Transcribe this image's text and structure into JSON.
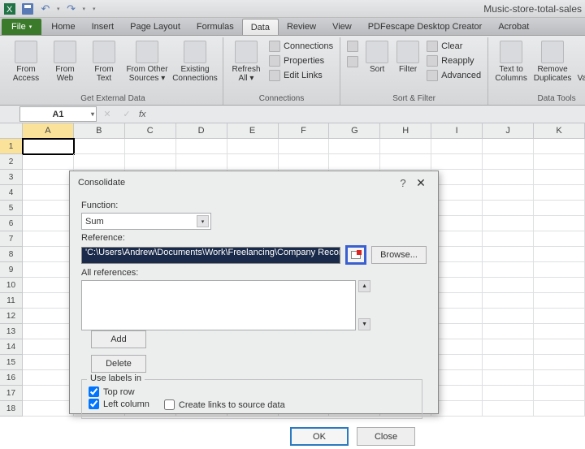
{
  "workbook_title": "Music-store-total-sales",
  "tabs": [
    "File",
    "Home",
    "Insert",
    "Page Layout",
    "Formulas",
    "Data",
    "Review",
    "View",
    "PDFescape Desktop Creator",
    "Acrobat"
  ],
  "active_tab": "Data",
  "ribbon": {
    "external": {
      "label": "Get External Data",
      "buttons": [
        "From\nAccess",
        "From\nWeb",
        "From\nText",
        "From Other\nSources ▾",
        "Existing\nConnections"
      ]
    },
    "connections": {
      "label": "Connections",
      "refresh": "Refresh\nAll ▾",
      "items": [
        "Connections",
        "Properties",
        "Edit Links"
      ]
    },
    "sortfilter": {
      "label": "Sort & Filter",
      "sort_small": "A↓Z",
      "sort": "Sort",
      "filter": "Filter",
      "clear": "Clear",
      "reapply": "Reapply",
      "advanced": "Advanced"
    },
    "datatools": {
      "label": "Data Tools",
      "text_to_columns": "Text to\nColumns",
      "remove_dup": "Remove\nDuplicates",
      "validation": "Data\nValidation ▾"
    }
  },
  "namebox": "A1",
  "columns": [
    "A",
    "B",
    "C",
    "D",
    "E",
    "F",
    "G",
    "H",
    "I",
    "J",
    "K"
  ],
  "rows": [
    1,
    2,
    3,
    4,
    5,
    6,
    7,
    8,
    9,
    10,
    11,
    12,
    13,
    14,
    15,
    16,
    17,
    18
  ],
  "dialog": {
    "title": "Consolidate",
    "function_label": "Function:",
    "function_value": "Sum",
    "reference_label": "Reference:",
    "reference_value": "'C:\\Users\\Andrew\\Documents\\Work\\Freelancing\\Company Records\\NY",
    "browse": "Browse...",
    "all_refs_label": "All references:",
    "add": "Add",
    "delete": "Delete",
    "legend": "Use labels in",
    "top_row": "Top row",
    "left_col": "Left column",
    "create_links": "Create links to source data",
    "ok": "OK",
    "close": "Close"
  }
}
